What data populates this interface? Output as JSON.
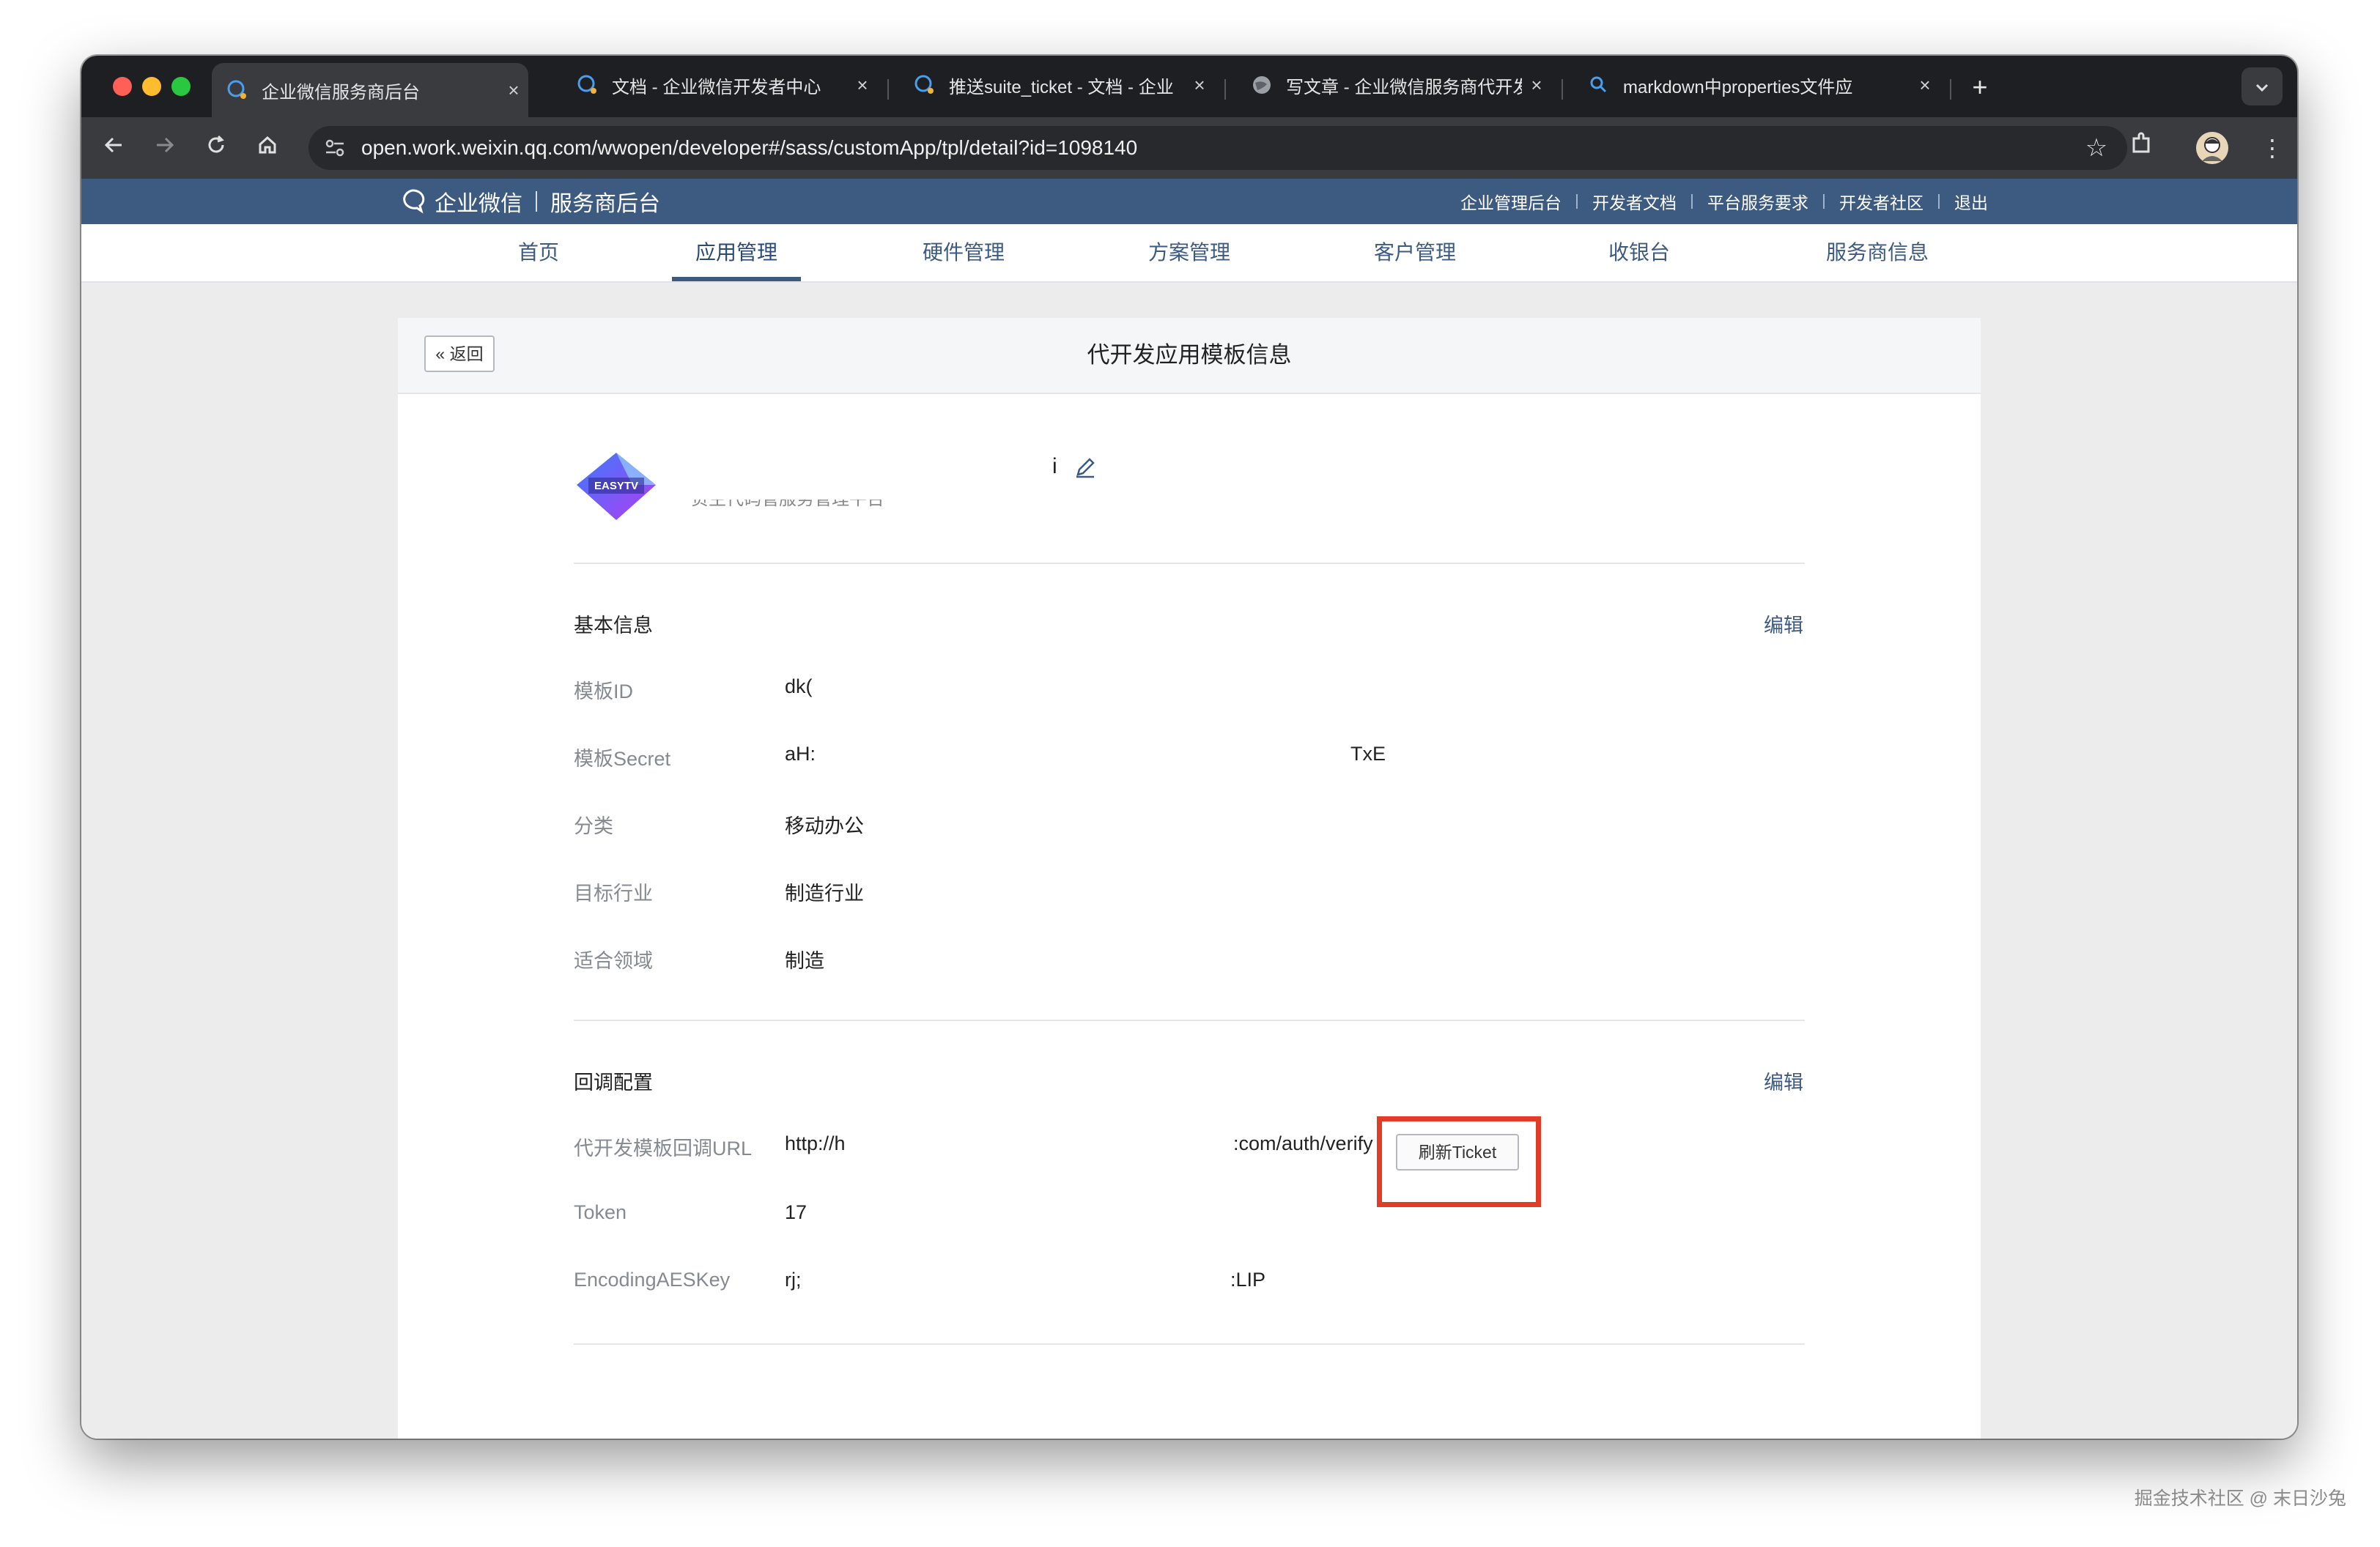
{
  "browser": {
    "tabs": [
      {
        "title": "企业微信服务商后台",
        "favicon": "wecom-icon",
        "active": true
      },
      {
        "title": "文档 - 企业微信开发者中心",
        "favicon": "wecom-icon",
        "active": false
      },
      {
        "title": "推送suite_ticket - 文档 - 企业",
        "favicon": "wecom-icon",
        "active": false
      },
      {
        "title": "写文章 - 企业微信服务商代开发",
        "favicon": "globe-icon",
        "active": false
      },
      {
        "title": "markdown中properties文件应",
        "favicon": "search-icon",
        "active": false
      }
    ],
    "close_glyph": "×",
    "new_tab_glyph": "+",
    "url": "open.work.weixin.qq.com/wwopen/developer#/sass/customApp/tpl/detail?id=1098140"
  },
  "site": {
    "brand_name": "企业微信",
    "brand_suffix": "服务商后台",
    "top_links": [
      "企业管理后台",
      "开发者文档",
      "平台服务要求",
      "开发者社区",
      "退出"
    ],
    "nav": [
      {
        "label": "首页",
        "active": false
      },
      {
        "label": "应用管理",
        "active": true
      },
      {
        "label": "硬件管理",
        "active": false
      },
      {
        "label": "方案管理",
        "active": false
      },
      {
        "label": "客户管理",
        "active": false
      },
      {
        "label": "收银台",
        "active": false
      },
      {
        "label": "服务商信息",
        "active": false
      }
    ]
  },
  "card": {
    "back_label": "« 返回",
    "title": "代开发应用模板信息",
    "app_name_fragment": "i",
    "app_desc": "负主代码管服务管理平台",
    "logo_text": "EASYTV",
    "basic": {
      "section_title": "基本信息",
      "edit_label": "编辑",
      "rows": [
        {
          "label": "模板ID",
          "value": "dk(",
          "value_tail": ""
        },
        {
          "label": "模板Secret",
          "value": "aH:",
          "value_tail": "TxE"
        },
        {
          "label": "分类",
          "value": "移动办公",
          "value_tail": ""
        },
        {
          "label": "目标行业",
          "value": "制造行业",
          "value_tail": ""
        },
        {
          "label": "适合领域",
          "value": "制造",
          "value_tail": ""
        }
      ]
    },
    "callback": {
      "section_title": "回调配置",
      "edit_label": "编辑",
      "rows": [
        {
          "label": "代开发模板回调URL",
          "value": "http://h",
          "value_tail": ":com/auth/verify"
        },
        {
          "label": "Token",
          "value": "17",
          "value_tail": ""
        },
        {
          "label": "EncodingAESKey",
          "value": "rj;",
          "value_tail": ":LIP"
        }
      ],
      "refresh_label": "刷新Ticket"
    }
  },
  "watermark": "掘金技术社区 @ 末日沙兔",
  "colors": {
    "brand_blue": "#3d5a80",
    "highlight_red": "#e23b26"
  }
}
